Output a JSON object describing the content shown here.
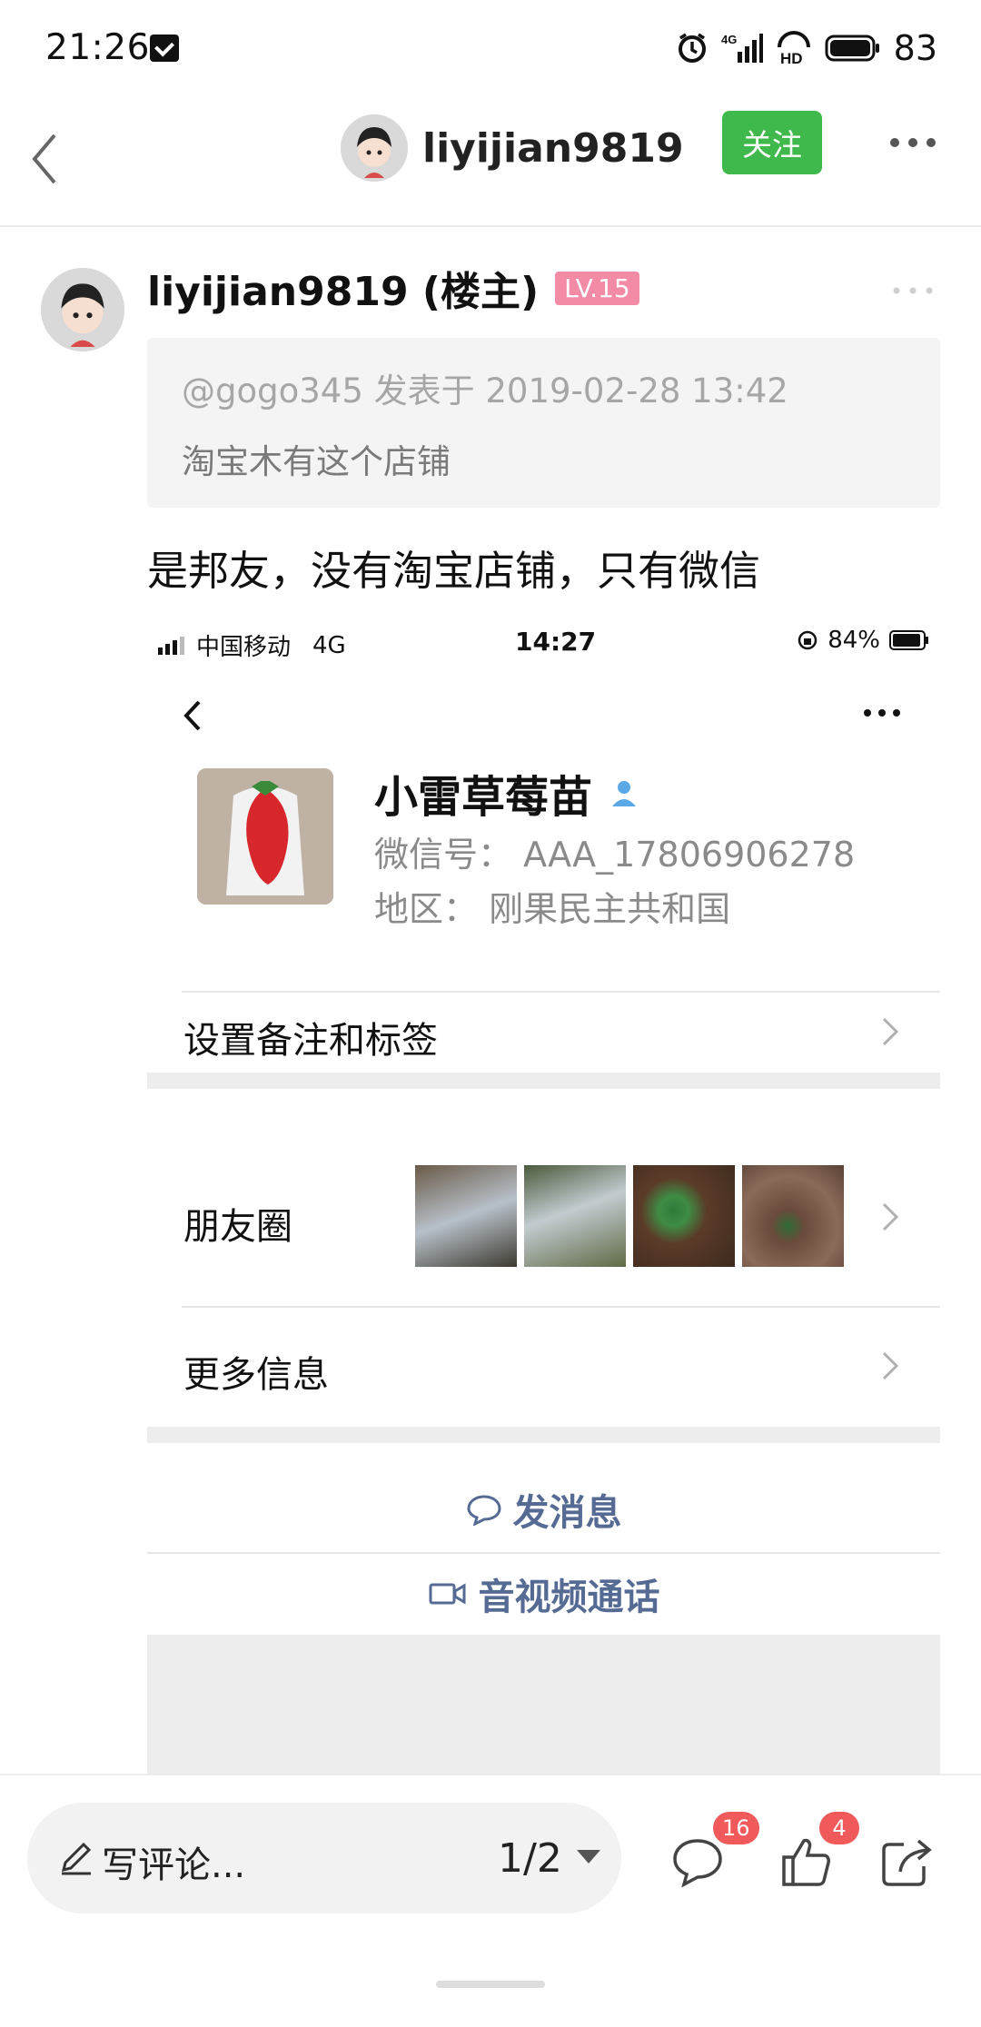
{
  "status_bar": {
    "time": "21:26",
    "network": "4G",
    "battery": "83",
    "icons": [
      "notification-icon",
      "alarm-icon",
      "signal-icon",
      "hd-icon",
      "battery-icon"
    ]
  },
  "header": {
    "username": "liyijian9819",
    "follow_label": "关注"
  },
  "post": {
    "author": "liyijian9819 (楼主)",
    "level_badge": "LV.15",
    "quote_meta": "@gogo345 发表于 2019-02-28 13:42",
    "quote_text": "淘宝木有这个店铺",
    "body_text": "是邦友，没有淘宝店铺，只有微信"
  },
  "embedded_screenshot": {
    "carrier": "中国移动",
    "network": "4G",
    "time": "14:27",
    "battery": "84%",
    "contact_name": "小雷草莓苗",
    "wechat_id": "微信号： AAA_17806906278",
    "region": "地区： 刚果民主共和国",
    "rows": {
      "remark": "设置备注和标签",
      "moments": "朋友圈",
      "more_info": "更多信息"
    },
    "actions": {
      "message": "发消息",
      "call": "音视频通话"
    }
  },
  "bottom_bar": {
    "comment_placeholder": "写评论...",
    "page_indicator": "1/2",
    "comment_count": "16",
    "like_count": "4"
  },
  "colors": {
    "follow_green": "#40b94c",
    "level_pink": "#f48ba6",
    "badge_red": "#f05a5a",
    "link_blue": "#566b94"
  }
}
